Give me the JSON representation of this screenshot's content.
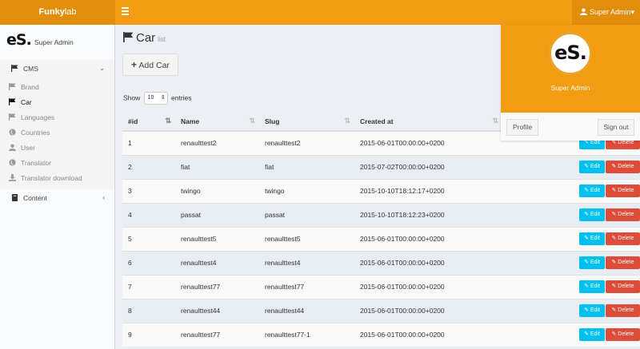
{
  "topbar": {
    "logo_part1": "Funky",
    "logo_part2": "lab",
    "user_label": "Super Admin",
    "caret": "▾",
    "bg_color": "#f39c12"
  },
  "sidebar": {
    "logo_text": "eS.",
    "user_name": "Super Admin",
    "cms_label": "CMS",
    "cms_chevron": "⌄",
    "items": [
      {
        "label": "Brand",
        "icon": "flag-icon"
      },
      {
        "label": "Car",
        "icon": "flag-icon",
        "active": true
      },
      {
        "label": "Languages",
        "icon": "flag-icon"
      },
      {
        "label": "Countries",
        "icon": "globe-icon"
      },
      {
        "label": "User",
        "icon": "user-icon"
      },
      {
        "label": "Translator",
        "icon": "globe-icon"
      },
      {
        "label": "Translator download",
        "icon": "download-icon"
      }
    ],
    "content_label": "Content",
    "content_chevron": "‹"
  },
  "main": {
    "title": "Car",
    "subtitle": "list",
    "add_button": "Add Car",
    "add_plus": "+",
    "show_label": "Show",
    "entries_value": "10",
    "entries_label": "entries"
  },
  "table": {
    "columns": [
      "#id",
      "Name",
      "Slug",
      "Created at"
    ],
    "edit_label": "Edit",
    "delete_label": "Delete",
    "rows": [
      {
        "id": "1",
        "name": "renaulttest2",
        "slug": "renaulttest2",
        "created": "2015-06-01T00:00:00+0200"
      },
      {
        "id": "2",
        "name": "fiat",
        "slug": "fiat",
        "created": "2015-07-02T00:00:00+0200"
      },
      {
        "id": "3",
        "name": "twingo",
        "slug": "twingo",
        "created": "2015-10-10T18:12:17+0200"
      },
      {
        "id": "4",
        "name": "passat",
        "slug": "passat",
        "created": "2015-10-10T18:12:23+0200"
      },
      {
        "id": "5",
        "name": "renaulttest5",
        "slug": "renaulttest5",
        "created": "2015-06-01T00:00:00+0200"
      },
      {
        "id": "6",
        "name": "renaulttest4",
        "slug": "renaulttest4",
        "created": "2015-06-01T00:00:00+0200"
      },
      {
        "id": "7",
        "name": "renaulttest77",
        "slug": "renaulttest77",
        "created": "2015-06-01T00:00:00+0200"
      },
      {
        "id": "8",
        "name": "renaulttest44",
        "slug": "renaulttest44",
        "created": "2015-06-01T00:00:00+0200"
      },
      {
        "id": "9",
        "name": "renaulttest77",
        "slug": "renaulttest77-1",
        "created": "2015-06-01T00:00:00+0200"
      }
    ]
  },
  "dropdown": {
    "avatar_text": "eS.",
    "name": "Super Admin",
    "profile_label": "Profile",
    "signout_label": "Sign out"
  },
  "colors": {
    "orange": "#f39c12",
    "info": "#00c0ef",
    "danger": "#dd4b39"
  }
}
